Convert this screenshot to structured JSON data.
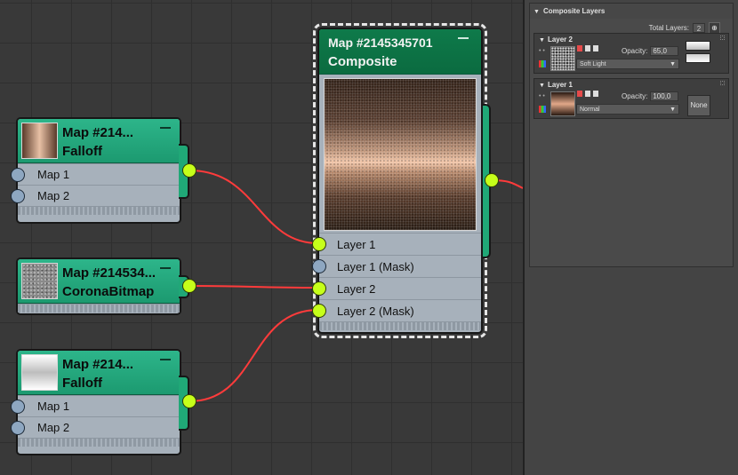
{
  "canvas": {
    "nodes": {
      "falloff_top": {
        "title": "Map #214...",
        "type": "Falloff",
        "inputs": [
          "Map 1",
          "Map 2"
        ]
      },
      "corona_bitmap": {
        "title": "Map #214534...",
        "type": "CoronaBitmap"
      },
      "falloff_bottom": {
        "title": "Map #214...",
        "type": "Falloff",
        "inputs": [
          "Map 1",
          "Map 2"
        ]
      },
      "composite": {
        "title": "Map #2145345701",
        "type": "Composite",
        "inputs": [
          "Layer 1",
          "Layer 1 (Mask)",
          "Layer 2",
          "Layer 2 (Mask)"
        ]
      }
    }
  },
  "panel": {
    "rollout_title": "Composite Layers",
    "total_layers_label": "Total Layers:",
    "total_layers_value": "2",
    "layers": [
      {
        "title": "Layer 2",
        "opacity_label": "Opacity:",
        "opacity_value": "65,0",
        "blend_mode": "Soft Light"
      },
      {
        "title": "Layer 1",
        "opacity_label": "Opacity:",
        "opacity_value": "100,0",
        "blend_mode": "Normal",
        "mask_button": "None"
      }
    ]
  },
  "colors": {
    "wire": "#ff3b3b",
    "socket_active": "#c6ff1a",
    "node_header": "#1c9a70",
    "composite_header": "#0b6b40"
  }
}
